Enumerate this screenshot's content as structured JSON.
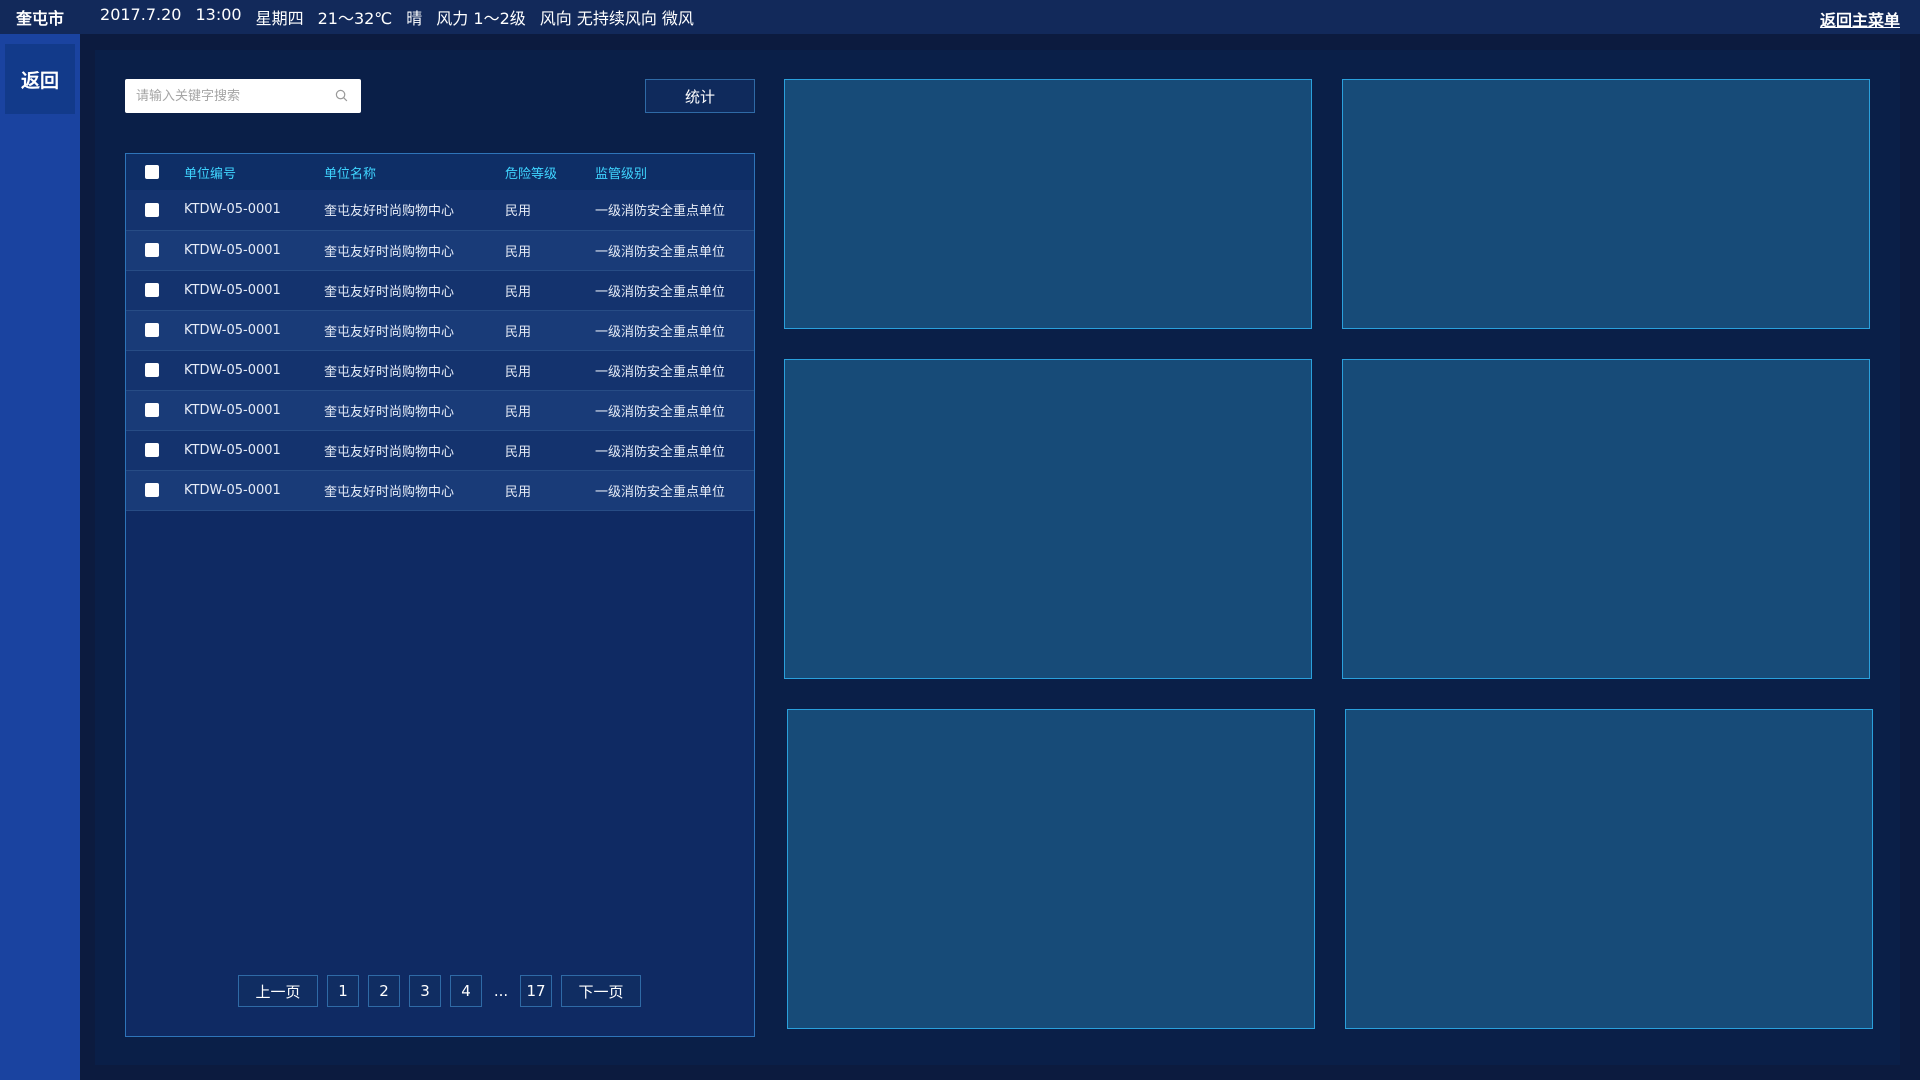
{
  "header": {
    "city": "奎屯市",
    "date": "2017.7.20",
    "time": "13:00",
    "weekday": "星期四",
    "temperature": "21～32℃",
    "weather": "晴",
    "wind_force": "风力 1～2级",
    "wind_direction": "风向 无持续风向 微风",
    "back_main_label": "返回主菜单"
  },
  "sidebar": {
    "back_label": "返回"
  },
  "search": {
    "placeholder": "请输入关键字搜索",
    "icon": "search-icon"
  },
  "toolbar": {
    "stat_label": "统计"
  },
  "table": {
    "headers": [
      "单位编号",
      "单位名称",
      "危险等级",
      "监管级别"
    ],
    "rows": [
      [
        "KTDW-05-0001",
        "奎屯友好时尚购物中心",
        "民用",
        "一级消防安全重点单位"
      ],
      [
        "KTDW-05-0001",
        "奎屯友好时尚购物中心",
        "民用",
        "一级消防安全重点单位"
      ],
      [
        "KTDW-05-0001",
        "奎屯友好时尚购物中心",
        "民用",
        "一级消防安全重点单位"
      ],
      [
        "KTDW-05-0001",
        "奎屯友好时尚购物中心",
        "民用",
        "一级消防安全重点单位"
      ],
      [
        "KTDW-05-0001",
        "奎屯友好时尚购物中心",
        "民用",
        "一级消防安全重点单位"
      ],
      [
        "KTDW-05-0001",
        "奎屯友好时尚购物中心",
        "民用",
        "一级消防安全重点单位"
      ],
      [
        "KTDW-05-0001",
        "奎屯友好时尚购物中心",
        "民用",
        "一级消防安全重点单位"
      ],
      [
        "KTDW-05-0001",
        "奎屯友好时尚购物中心",
        "民用",
        "一级消防安全重点单位"
      ]
    ]
  },
  "pagination": {
    "prev_label": "上一页",
    "pages": [
      "1",
      "2",
      "3",
      "4"
    ],
    "ellipsis": "...",
    "last_page": "17",
    "next_label": "下一页"
  },
  "colors": {
    "background": "#0c1b3f",
    "sidebar": "#1a43a0",
    "header_text": "#3fd4ff",
    "panel_fill": "#174b78",
    "panel_border": "#2aa0dc"
  }
}
